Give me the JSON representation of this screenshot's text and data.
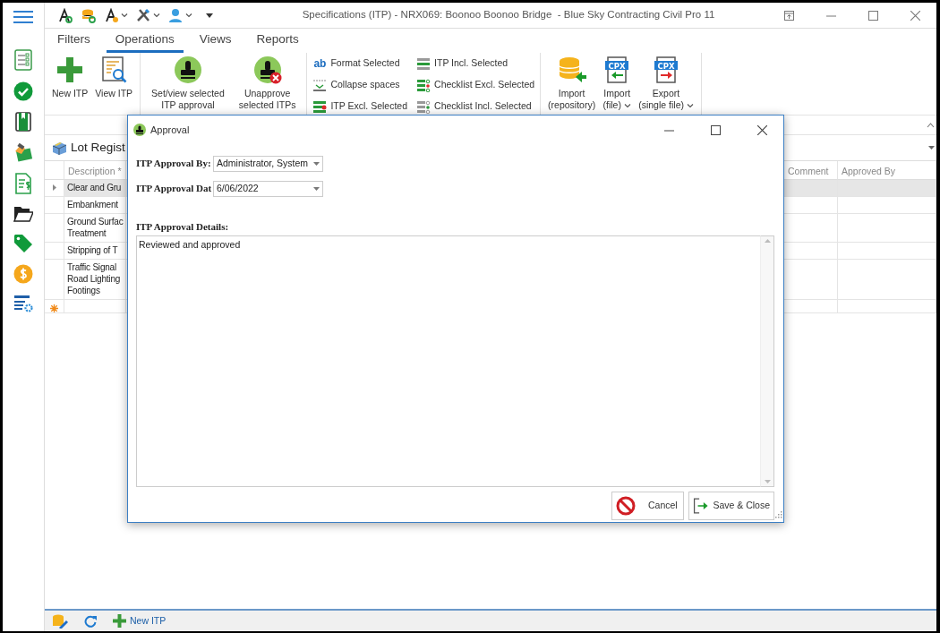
{
  "window": {
    "title": "Specifications (ITP) - NRX069: Boonoo Boonoo Bridge  - Blue Sky Contracting Civil Pro 11"
  },
  "quick_access": [
    {
      "dropdown": false
    },
    {
      "dropdown": false
    },
    {
      "dropdown": true
    },
    {
      "dropdown": true
    },
    {
      "dropdown": true
    }
  ],
  "ribbon_tabs": [
    {
      "label": "Filters",
      "selected": false
    },
    {
      "label": "Operations",
      "selected": true
    },
    {
      "label": "Views",
      "selected": false
    },
    {
      "label": "Reports",
      "selected": false
    }
  ],
  "ribbon_groups": [
    {
      "kind": "large",
      "buttons": [
        {
          "lines": [
            "New ITP"
          ],
          "dropdown": false
        },
        {
          "lines": [
            "View ITP"
          ],
          "dropdown": false
        }
      ]
    },
    {
      "kind": "large",
      "buttons": [
        {
          "lines": [
            "Set/view selected",
            "ITP approval"
          ],
          "dropdown": false
        },
        {
          "lines": [
            "Unapprove",
            "selected ITPs"
          ],
          "dropdown": false
        }
      ]
    },
    {
      "kind": "small",
      "buttons": [
        {
          "label": "Format Selected",
          "badge": "ab"
        },
        {
          "label": "Collapse spaces"
        },
        {
          "label": "ITP Excl. Selected"
        },
        {
          "label": "ITP Incl. Selected"
        },
        {
          "label": "Checklist Excl. Selected"
        },
        {
          "label": "Checklist Incl. Selected"
        }
      ]
    },
    {
      "kind": "large",
      "buttons": [
        {
          "lines": [
            "Import",
            "(repository)"
          ],
          "dropdown": false
        },
        {
          "lines": [
            "Import",
            "(file)"
          ],
          "dropdown": true,
          "badge": "CPX"
        },
        {
          "lines": [
            "Export",
            "(single file)"
          ],
          "dropdown": true,
          "badge": "CPX"
        }
      ]
    }
  ],
  "panel": {
    "title": "Lot Regist"
  },
  "grid": {
    "columns": [
      {
        "label": "Description *"
      },
      {
        "label": "Comment"
      },
      {
        "label": "Approved By"
      }
    ],
    "rows": [
      {
        "kind": "data",
        "lines": [
          "Clear and Gru"
        ],
        "selected": true,
        "current": true
      },
      {
        "kind": "data",
        "lines": [
          "Embankment"
        ],
        "selected": false,
        "current": false
      },
      {
        "kind": "data",
        "lines": [
          "Ground Surfac",
          "Treatment"
        ],
        "selected": false,
        "current": false
      },
      {
        "kind": "data",
        "lines": [
          "Stripping of T"
        ],
        "selected": false,
        "current": false
      },
      {
        "kind": "data",
        "lines": [
          "Traffic Signal",
          "Road Lighting",
          "Footings"
        ],
        "selected": false,
        "current": false
      },
      {
        "kind": "new",
        "selected": false,
        "current": false
      }
    ]
  },
  "dialog": {
    "title": "Approval",
    "fields": [
      {
        "label": "ITP Approval By:",
        "value": "Administrator, System"
      },
      {
        "label": "ITP Approval Dat",
        "value": "6/06/2022"
      }
    ],
    "details_label": "ITP Approval Details:",
    "details_value": "Reviewed and approved",
    "buttons": [
      {
        "kind": "cancel",
        "label": "Cancel"
      },
      {
        "kind": "save",
        "label": "Save & Close"
      }
    ]
  },
  "bottom_bar": {
    "new_label": "New ITP"
  }
}
